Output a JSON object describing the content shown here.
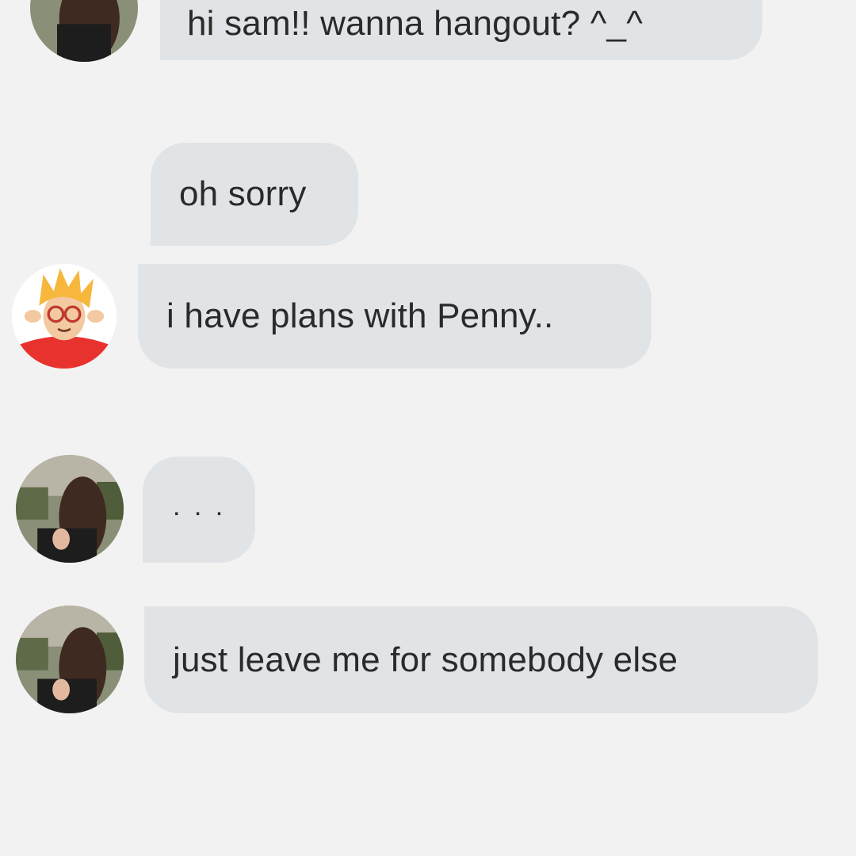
{
  "conversation": {
    "messages": [
      {
        "sender": "girl",
        "avatar": "photo-avatar-girl",
        "text": "hi sam!! wanna hangout? ^_^"
      },
      {
        "sender": "sam",
        "avatar": "",
        "text": "oh sorry"
      },
      {
        "sender": "sam",
        "avatar": "cartoon-avatar-sam",
        "text": "i have plans with Penny.."
      },
      {
        "sender": "girl",
        "avatar": "photo-avatar-girl",
        "text": ". . ."
      },
      {
        "sender": "girl",
        "avatar": "photo-avatar-girl",
        "text": "just leave me for somebody else"
      }
    ]
  },
  "colors": {
    "background": "#f3f2f3",
    "bubble": "#e1e4e6",
    "text": "#2a2a2a",
    "sam_shirt": "#e8322e",
    "sam_hair": "#f6b73c"
  }
}
